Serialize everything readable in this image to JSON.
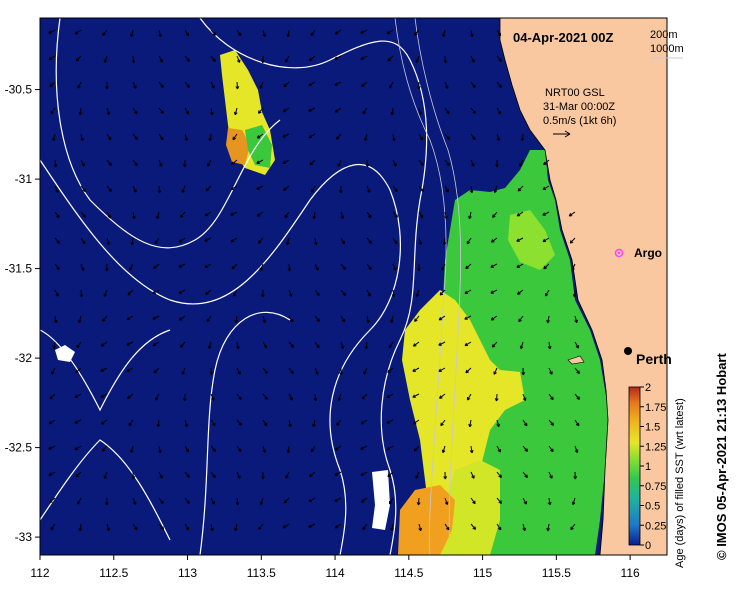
{
  "map": {
    "date_label": "04-Apr-2021 00Z",
    "depth_contours": [
      "200m",
      "1000m"
    ],
    "current_label": [
      "NRT00 GSL",
      "31-Mar 00:00Z",
      "0.5m/s (1kt 6h)"
    ],
    "places": [
      {
        "name": "Argo",
        "lon": 115.77,
        "lat": -31.5
      },
      {
        "name": "Perth",
        "lon": 115.86,
        "lat": -31.95
      }
    ],
    "credit": "© IMOS 05-Apr-2021 21:13 Hobart",
    "x_axis": {
      "range": [
        112.0,
        116.25
      ],
      "ticks": [
        "112",
        "112.5",
        "113",
        "113.5",
        "114",
        "114.5",
        "115",
        "115.5",
        "116"
      ]
    },
    "y_axis": {
      "range": [
        -33.1,
        -30.1
      ],
      "ticks": [
        "-30.5",
        "-31",
        "-31.5",
        "-32",
        "-32.5",
        "-33"
      ]
    },
    "colorbar": {
      "title": "Age (days) of filled SST (wrt latest)",
      "ticks": [
        "0",
        "0.25",
        "0.5",
        "0.75",
        "1",
        "1.25",
        "1.5",
        "1.75",
        "2"
      ],
      "range": [
        0,
        2
      ],
      "colors": [
        "#0a1e8c",
        "#1e78c8",
        "#20b4a0",
        "#30c850",
        "#8ce030",
        "#e6e628",
        "#f0b41e",
        "#e6781e",
        "#b4281e"
      ]
    },
    "colors": {
      "ocean": "#0a1a7a",
      "land": "#fac8a0",
      "contour": "#ffffff",
      "arrow": "#000000",
      "argo": "#ff40ff"
    }
  }
}
